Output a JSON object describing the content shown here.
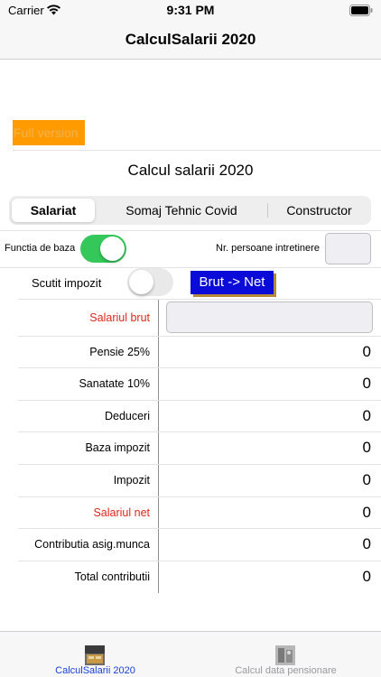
{
  "status_bar": {
    "carrier": "Carrier",
    "time": "9:31 PM"
  },
  "nav": {
    "title": "CalculSalarii 2020"
  },
  "full_version": {
    "label": "Full version"
  },
  "section_title": "Calcul salarii 2020",
  "segments": [
    {
      "label": "Salariat",
      "selected": true
    },
    {
      "label": "Somaj Tehnic Covid",
      "selected": false
    },
    {
      "label": "Constructor",
      "selected": false
    }
  ],
  "options": {
    "functia_label": "Functia de baza",
    "functia_on": true,
    "persoane_label": "Nr. persoane intretinere",
    "persoane_value": "",
    "scutit_label": "Scutit impozit",
    "scutit_on": false,
    "brut_net_label": "Brut -> Net"
  },
  "rows": [
    {
      "label": "Salariul brut",
      "value": "",
      "highlight": true,
      "input": true
    },
    {
      "label": "Pensie 25%",
      "value": "0"
    },
    {
      "label": "Sanatate 10%",
      "value": "0"
    },
    {
      "label": "Deduceri",
      "value": "0"
    },
    {
      "label": "Baza impozit",
      "value": "0"
    },
    {
      "label": "Impozit",
      "value": "0"
    },
    {
      "label": "Salariul net",
      "value": "0",
      "highlight": true
    },
    {
      "label": "Contributia asig.munca",
      "value": "0"
    },
    {
      "label": "Total contributii",
      "value": "0"
    }
  ],
  "tabs": [
    {
      "label": "CalculSalarii 2020",
      "active": true,
      "icon": "calculator-photo-icon"
    },
    {
      "label": "Calcul data pensionare",
      "active": false,
      "icon": "retirement-photo-icon"
    }
  ],
  "colors": {
    "accent_blue": "#0b0bd9",
    "highlight_red": "#e0261c",
    "switch_on": "#34c759",
    "full_version_bg": "#ff9a00",
    "tab_active": "#1a3fd8"
  }
}
